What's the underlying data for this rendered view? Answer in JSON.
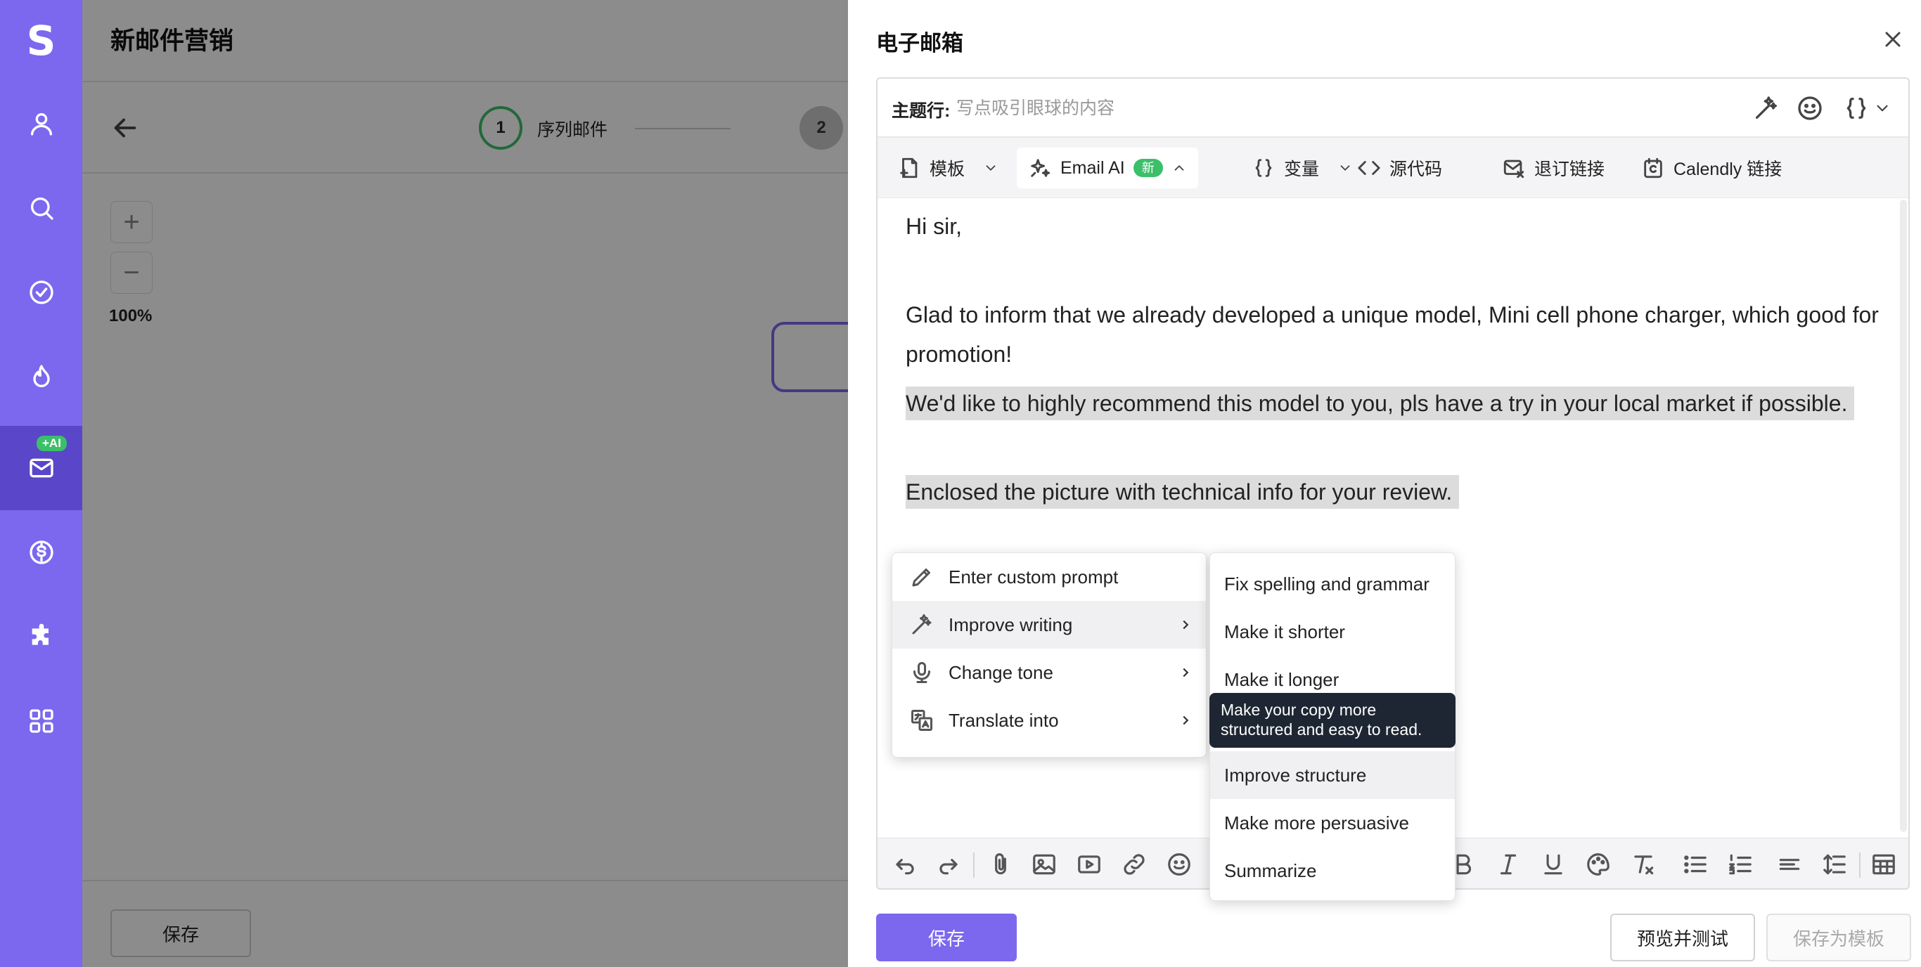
{
  "app": {
    "brand_initial": "S"
  },
  "sidebar": {
    "items": [
      {
        "icon": "user-icon"
      },
      {
        "icon": "search-icon"
      },
      {
        "icon": "check-circle-icon"
      },
      {
        "icon": "flame-icon"
      },
      {
        "icon": "mail-icon",
        "badge": "+AI",
        "active": true
      },
      {
        "icon": "dollar-icon"
      },
      {
        "icon": "puzzle-icon"
      },
      {
        "icon": "grid-icon"
      }
    ]
  },
  "page": {
    "title": "新邮件营销",
    "steps": [
      {
        "number": "1",
        "label": "序列邮件"
      },
      {
        "number": "2"
      }
    ],
    "zoom_level": "100%",
    "save_label": "保存"
  },
  "drawer": {
    "title": "电子邮箱",
    "subject": {
      "label": "主题行:",
      "placeholder": "写点吸引眼球的内容",
      "value": ""
    },
    "toolbar": {
      "template": "模板",
      "email_ai": "Email AI",
      "new_badge": "新",
      "variables": "变量",
      "source_code": "源代码",
      "unsubscribe": "退订链接",
      "calendly": "Calendly 链接"
    },
    "body": {
      "greeting": "Hi sir,",
      "p1": "Glad to inform that we already developed a unique model, Mini cell phone charger, which good for promotion!",
      "p2": "We'd like to highly recommend this model to you, pls have a try in your local market if possible.",
      "p3": "Enclosed the picture with technical info for your review."
    },
    "ai_menu": {
      "items": [
        {
          "label": "Enter custom prompt",
          "icon": "pencil-icon"
        },
        {
          "label": "Improve writing",
          "icon": "magic-wand-icon",
          "has_submenu": true
        },
        {
          "label": "Change tone",
          "icon": "microphone-icon",
          "has_submenu": true
        },
        {
          "label": "Translate into",
          "icon": "translate-icon",
          "has_submenu": true
        }
      ]
    },
    "sub_menu": {
      "items": [
        {
          "label": "Fix spelling and grammar"
        },
        {
          "label": "Make it shorter"
        },
        {
          "label": "Make it longer"
        },
        {
          "label": "Improve structure"
        },
        {
          "label": "Make more persuasive"
        },
        {
          "label": "Summarize"
        }
      ],
      "tooltip": "Make your copy more structured and easy to read."
    },
    "footer": {
      "save": "保存",
      "preview": "预览并测试",
      "save_template": "保存为模板"
    }
  },
  "colors": {
    "brand": "#7b68ee",
    "brand_dark": "#5a46c9",
    "accent_green": "#3cbf6a",
    "tooltip_bg": "#1e2633"
  }
}
